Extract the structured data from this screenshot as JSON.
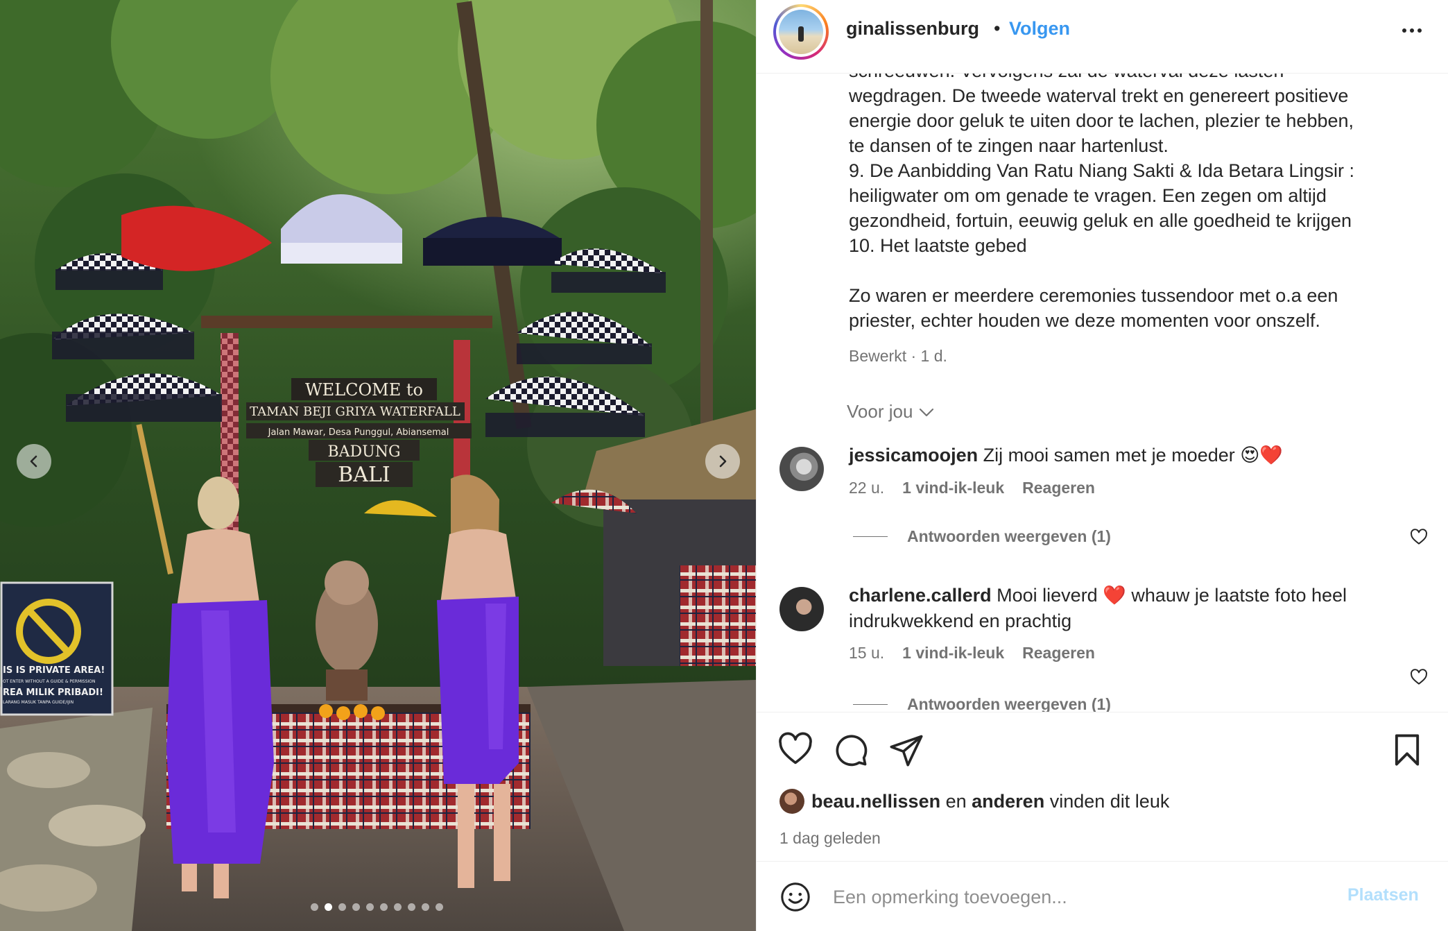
{
  "post": {
    "author": "ginalissenburg",
    "separator": "•",
    "follow_label": "Volgen",
    "more_icon": "more-horizontal-icon",
    "caption": "schreeuwen. Vervolgens zal de waterval deze lasten\nwegdragen. De tweede waterval trekt en genereert positieve\nenergie door geluk te uiten door te lachen, plezier te hebben,\nte dansen of te zingen naar hartenlust.\n9. De Aanbidding Van Ratu Niang Sakti & Ida Betara Lingsir :\nheiligwater om om genade te vragen. Een zegen om altijd\ngezondheid, fortuin, eeuwig geluk en alle goedheid te krijgen\n10. Het laatste gebed\n\nZo waren er meerdere ceremonies tussendoor met o.a een\npriester, echter houden we deze momenten voor onszelf.",
    "edited": "Bewerkt · 1 d.",
    "for_you": "Voor jou"
  },
  "photo": {
    "sign_lines": [
      "WELCOME to",
      "TAMAN BEJI GRIYA WATERFALL",
      "Jalan Mawar, Desa Punggul, Abiansemal",
      "BADUNG",
      "BALI"
    ],
    "private_sign": [
      "IS IS PRIVATE AREA!",
      "OT ENTER WITHOUT A GUIDE & PERMISSION",
      "REA MILIK PRIBADI!",
      "LARANG MASUK TANPA GUIDE/IJIN"
    ],
    "carousel": {
      "count": 10,
      "active_index": 1
    }
  },
  "comments": [
    {
      "user": "jessicamoojen",
      "text": "Zij mooi samen met je moeder 😍❤️",
      "time": "22 u.",
      "likes": "1 vind-ik-leuk",
      "reply_label": "Reageren",
      "view_replies": "Antwoorden weergeven (1)"
    },
    {
      "user": "charlene.callerd",
      "text": "Mooi lieverd ❤️ whauw je laatste foto heel indrukwekkend en prachtig",
      "time": "15 u.",
      "likes": "1 vind-ik-leuk",
      "reply_label": "Reageren",
      "view_replies": "Antwoorden weergeven (1)"
    }
  ],
  "likes": {
    "first_user": "beau.nellissen",
    "connector": "en",
    "others": "anderen",
    "suffix": "vinden dit leuk",
    "time_ago": "1 dag geleden"
  },
  "composer": {
    "placeholder": "Een opmerking toevoegen...",
    "post_label": "Plaatsen"
  },
  "colors": {
    "link_blue": "#3897f0",
    "post_disabled": "#b2dffc",
    "muted_text": "#737373",
    "dress_purple": "#6a2bd9"
  }
}
